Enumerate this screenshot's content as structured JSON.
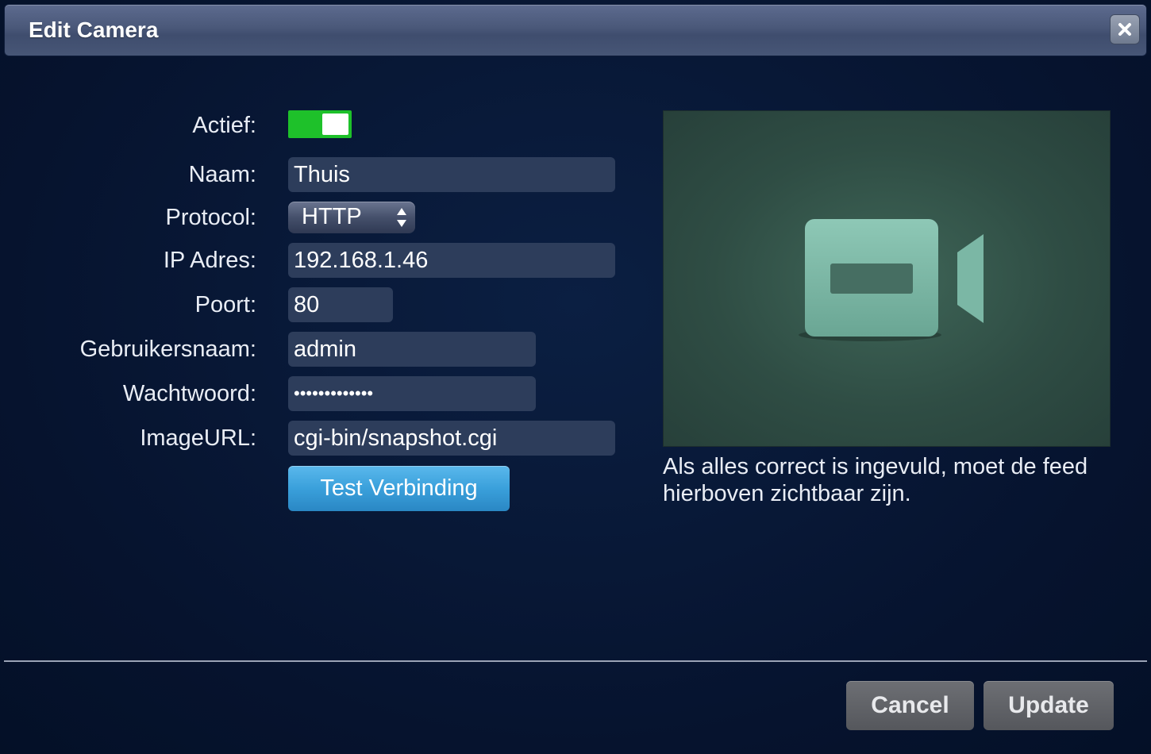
{
  "dialog": {
    "title": "Edit Camera",
    "close_icon": "close-icon"
  },
  "form": {
    "active_label": "Actief:",
    "active_value": true,
    "name_label": "Naam:",
    "name_value": "Thuis",
    "protocol_label": "Protocol:",
    "protocol_value": "HTTP",
    "ip_label": "IP Adres:",
    "ip_value": "192.168.1.46",
    "port_label": "Poort:",
    "port_value": "80",
    "username_label": "Gebruikersnaam:",
    "username_value": "admin",
    "password_label": "Wachtwoord:",
    "password_value": "•••••••••••••",
    "imageurl_label": "ImageURL:",
    "imageurl_value": "cgi-bin/snapshot.cgi",
    "test_button": "Test Verbinding"
  },
  "preview": {
    "icon": "video-camera-icon",
    "caption": "Als alles correct is ingevuld, moet de feed hierboven zichtbaar zijn."
  },
  "footer": {
    "cancel_label": "Cancel",
    "update_label": "Update"
  },
  "colors": {
    "background": "#071631",
    "toggle_on": "#1ec12a",
    "field_bg": "#2d3d5b",
    "test_button": "#3aa0db",
    "footer_button": "#606266"
  }
}
